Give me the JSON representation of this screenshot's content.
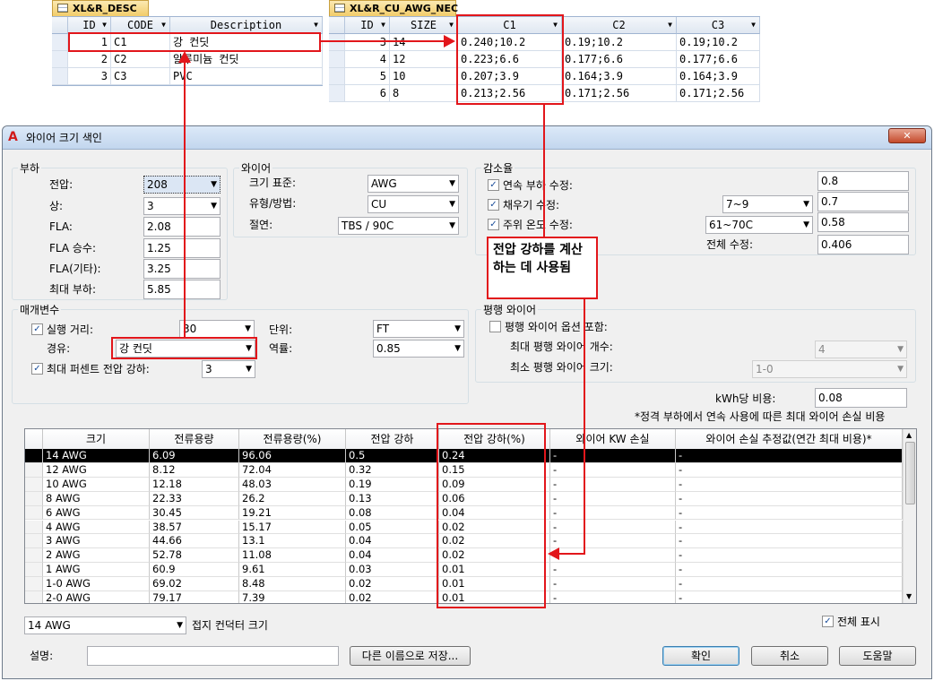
{
  "desc_table": {
    "tab": "XL&R_DESC",
    "headers": [
      "ID",
      "CODE",
      "Description"
    ],
    "rows": [
      {
        "id": "1",
        "code": "C1",
        "desc": "강 컨딧"
      },
      {
        "id": "2",
        "code": "C2",
        "desc": "알루미늄 컨딧"
      },
      {
        "id": "3",
        "code": "C3",
        "desc": "PVC"
      }
    ]
  },
  "awg_table": {
    "tab": "XL&R_CU_AWG_NEC",
    "headers": [
      "ID",
      "SIZE",
      "C1",
      "C2",
      "C3"
    ],
    "rows": [
      {
        "id": "3",
        "size": "14",
        "c1": "0.240;10.2",
        "c2": "0.19;10.2",
        "c3": "0.19;10.2"
      },
      {
        "id": "4",
        "size": "12",
        "c1": "0.223;6.6",
        "c2": "0.177;6.6",
        "c3": "0.177;6.6"
      },
      {
        "id": "5",
        "size": "10",
        "c1": "0.207;3.9",
        "c2": "0.164;3.9",
        "c3": "0.164;3.9"
      },
      {
        "id": "6",
        "size": "8",
        "c1": "0.213;2.56",
        "c2": "0.171;2.56",
        "c3": "0.171;2.56"
      }
    ]
  },
  "dialog": {
    "title": "와이어 크기 색인",
    "close": "✕",
    "load": {
      "group": "부하",
      "voltage_label": "전압:",
      "voltage": "208",
      "phase_label": "상:",
      "phase": "3",
      "fla_label": "FLA:",
      "fla": "2.08",
      "fla_mult_label": "FLA 승수:",
      "fla_mult": "1.25",
      "fla_other_label": "FLA(기타):",
      "fla_other": "3.25",
      "max_load_label": "최대 부하:",
      "max_load": "5.85"
    },
    "wire": {
      "group": "와이어",
      "size_std_label": "크기 표준:",
      "size_std": "AWG",
      "type_label": "유형/방법:",
      "type": "CU",
      "insulation_label": "절연:",
      "insulation": "TBS / 90C"
    },
    "derate": {
      "group": "감소율",
      "cont_label": "연속 부하 수정:",
      "cont": "0.8",
      "fill_label": "채우기 수정:",
      "fill_sel": "7~9",
      "fill": "0.7",
      "temp_label": "주위 온도 수정:",
      "temp_sel": "61~70C",
      "temp": "0.58",
      "total_label": "전체 수정:",
      "total": "0.406"
    },
    "callout": "전압 강하를 계산하는 데 사용됨",
    "params": {
      "group": "매개변수",
      "run_label": "실행 거리:",
      "run": "30",
      "unit_label": "단위:",
      "unit": "FT",
      "conduit_label": "경유:",
      "conduit": "강 컨딧",
      "pf_label": "역률:",
      "pf": "0.85",
      "maxvd_label": "최대 퍼센트 전압 강하:",
      "maxvd": "3"
    },
    "parallel": {
      "group": "평행 와이어",
      "include_label": "평행 와이어 옵션 포함:",
      "max_count_label": "최대 평행 와이어 개수:",
      "max_count": "4",
      "min_size_label": "최소 평행 와이어 크기:",
      "min_size": "1-0"
    },
    "kwh_label": "kWh당 비용:",
    "kwh": "0.08",
    "note": "*정격 부하에서 연속 사용에 따른 최대 와이어 손실 비용",
    "grid": {
      "headers": [
        "크기",
        "전류용량",
        "전류용량(%)",
        "전압 강하",
        "전압 강하(%)",
        "와이어 KW 손실",
        "와이어 손실 추정값(연간 최대 비용)*"
      ],
      "rows": [
        [
          "14 AWG",
          "6.09",
          "96.06",
          "0.5",
          "0.24",
          "-",
          "-"
        ],
        [
          "12 AWG",
          "8.12",
          "72.04",
          "0.32",
          "0.15",
          "-",
          "-"
        ],
        [
          "10 AWG",
          "12.18",
          "48.03",
          "0.19",
          "0.09",
          "-",
          "-"
        ],
        [
          "8 AWG",
          "22.33",
          "26.2",
          "0.13",
          "0.06",
          "-",
          "-"
        ],
        [
          "6 AWG",
          "30.45",
          "19.21",
          "0.08",
          "0.04",
          "-",
          "-"
        ],
        [
          "4 AWG",
          "38.57",
          "15.17",
          "0.05",
          "0.02",
          "-",
          "-"
        ],
        [
          "3 AWG",
          "44.66",
          "13.1",
          "0.04",
          "0.02",
          "-",
          "-"
        ],
        [
          "2 AWG",
          "52.78",
          "11.08",
          "0.04",
          "0.02",
          "-",
          "-"
        ],
        [
          "1 AWG",
          "60.9",
          "9.61",
          "0.03",
          "0.01",
          "-",
          "-"
        ],
        [
          "1-0 AWG",
          "69.02",
          "8.48",
          "0.02",
          "0.01",
          "-",
          "-"
        ],
        [
          "2-0 AWG",
          "79.17",
          "7.39",
          "0.02",
          "0.01",
          "-",
          "-"
        ]
      ]
    },
    "ground_sel": "14 AWG",
    "ground_label": "접지 컨덕터 크기",
    "show_all_label": "전체 표시",
    "desc_label": "설명:",
    "desc_value": "",
    "save_as": "다른 이름으로 저장...",
    "ok": "확인",
    "cancel": "취소",
    "help": "도움말"
  }
}
